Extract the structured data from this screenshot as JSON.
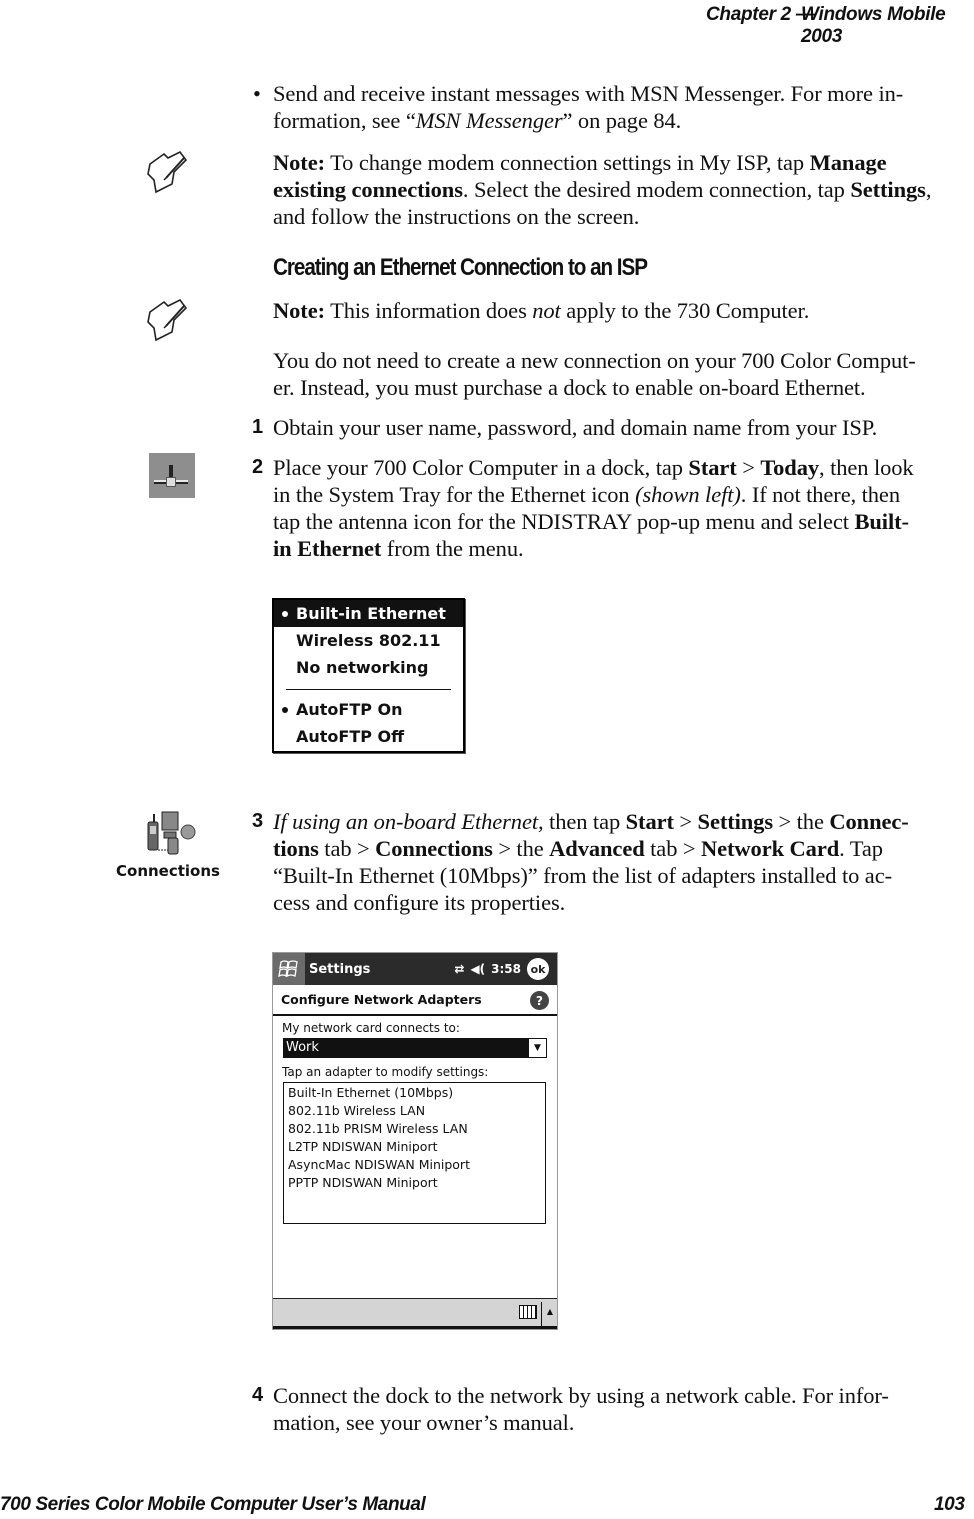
{
  "header": {
    "chapter": "Chapter  2  —",
    "title": "Windows Mobile 2003"
  },
  "bullet": {
    "symbol": "•",
    "text_1": "Send and receive instant messages with MSN Messenger. For more in-",
    "text_2a": "formation, see “",
    "text_2_italic": "MSN Messenger",
    "text_2b": "” on page 84."
  },
  "note1": {
    "label": "Note:",
    "line1a": " To change modem connection settings in My ISP, tap ",
    "line1_bold": "Manage",
    "line2_bold": "existing connections",
    "line2a": ". Select the desired modem connection, tap ",
    "line2_bold2": "Settings",
    "line2b": ",",
    "line3": "and follow the instructions on the screen."
  },
  "section_title": "Creating an Ethernet Connection to an ISP",
  "note2": {
    "label": "Note:",
    "text_a": " This information does ",
    "text_italic": "not",
    "text_b": " apply to the 730 Computer."
  },
  "intro": {
    "line1": "You do not need to create a new connection on your 700 Color Comput-",
    "line2": "er. Instead, you must purchase a dock to enable on-board Ethernet."
  },
  "steps": [
    {
      "num": "1",
      "line1": "Obtain your user name, password, and domain name from your ISP."
    },
    {
      "num": "2",
      "line1a": "Place your 700 Color Computer in a dock, tap ",
      "line1_b1": "Start",
      "line1_sep": " > ",
      "line1_b2": "Today",
      "line1b": ", then look",
      "line2a": "in the System Tray for the Ethernet icon ",
      "line2_italic": "(shown left)",
      "line2b": ". If not there, then",
      "line3a": "tap the antenna icon for the NDISTRAY pop-up menu and select ",
      "line3_bold": "Built-",
      "line4_bold": "in Ethernet",
      "line4b": " from the menu."
    },
    {
      "num": "3",
      "line1_italic": "If using an on-board Ethernet,",
      "line1a": " then tap ",
      "line1_b1": "Start",
      "line1_sep1": " > ",
      "line1_b2": "Settings",
      "line1_sep2": " > the ",
      "line1_b3": "Connec-",
      "line2_b1": "tions",
      "line2a": " tab > ",
      "line2_b2": "Connections",
      "line2b": " > the ",
      "line2_b3": "Advanced",
      "line2c": " tab > ",
      "line2_b4": "Network Card",
      "line2d": ". Tap",
      "line3": "“Built-In Ethernet (10Mbps)” from the list of adapters installed to ac-",
      "line4": "cess and configure its properties."
    },
    {
      "num": "4",
      "line1": "Connect the dock to the network by using a network cable. For infor-",
      "line2": "mation, see your owner’s manual."
    }
  ],
  "icons": {
    "note": "note-pencil-icon",
    "ethernet": "ethernet-tray-icon",
    "connections": "connections-icon",
    "connections_label": "Connections"
  },
  "popup_menu": {
    "items": [
      {
        "label": "Built-in Ethernet",
        "checked": true,
        "selected": true
      },
      {
        "label": "Wireless 802.11",
        "checked": false
      },
      {
        "label": "No networking",
        "checked": false
      },
      {
        "label": "AutoFTP On",
        "checked": true
      },
      {
        "label": "AutoFTP Off",
        "checked": false
      }
    ]
  },
  "ppc_screen": {
    "title": "Settings",
    "time": "3:58",
    "ok_label": "ok",
    "subheader": "Configure Network Adapters",
    "help_label": "?",
    "connects_label": "My network card connects to:",
    "connects_value": "Work",
    "adapters_label": "Tap an adapter to modify settings:",
    "adapters": [
      "Built-In Ethernet (10Mbps)",
      "802.11b Wireless LAN",
      "802.11b PRISM Wireless LAN",
      "L2TP NDISWAN Miniport",
      "AsyncMac NDISWAN Miniport",
      "PPTP NDISWAN Miniport"
    ]
  },
  "footer": {
    "manual_title": "700 Series Color Mobile Computer User’s Manual",
    "page_number": "103"
  }
}
